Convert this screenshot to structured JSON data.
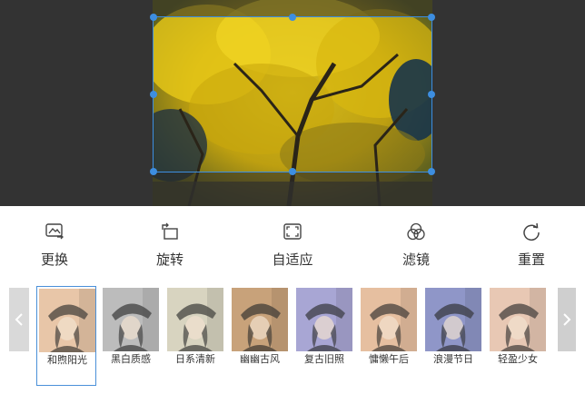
{
  "toolbar": {
    "tools": [
      {
        "label": "更换",
        "icon": "replace-image-icon"
      },
      {
        "label": "旋转",
        "icon": "rotate-icon"
      },
      {
        "label": "自适应",
        "icon": "fit-icon"
      },
      {
        "label": "滤镜",
        "icon": "filter-icon"
      },
      {
        "label": "重置",
        "icon": "reset-icon"
      }
    ]
  },
  "filters": {
    "items": [
      {
        "name": "和煦阳光",
        "tint": "#e9c6a8",
        "selected": true
      },
      {
        "name": "黑白质感",
        "tint": "#bdbdbd",
        "selected": false
      },
      {
        "name": "日系清新",
        "tint": "#d8d4c0",
        "selected": false
      },
      {
        "name": "幽幽古风",
        "tint": "#c9a27a",
        "selected": false
      },
      {
        "name": "复古旧照",
        "tint": "#a9a6d4",
        "selected": false
      },
      {
        "name": "慵懒午后",
        "tint": "#e6bfa0",
        "selected": false
      },
      {
        "name": "浪漫节日",
        "tint": "#8f96c8",
        "selected": false
      },
      {
        "name": "轻盈少女",
        "tint": "#e8c8b4",
        "selected": false
      }
    ]
  },
  "colors": {
    "accent": "#3d8ee0",
    "canvas_bg": "#333333"
  }
}
